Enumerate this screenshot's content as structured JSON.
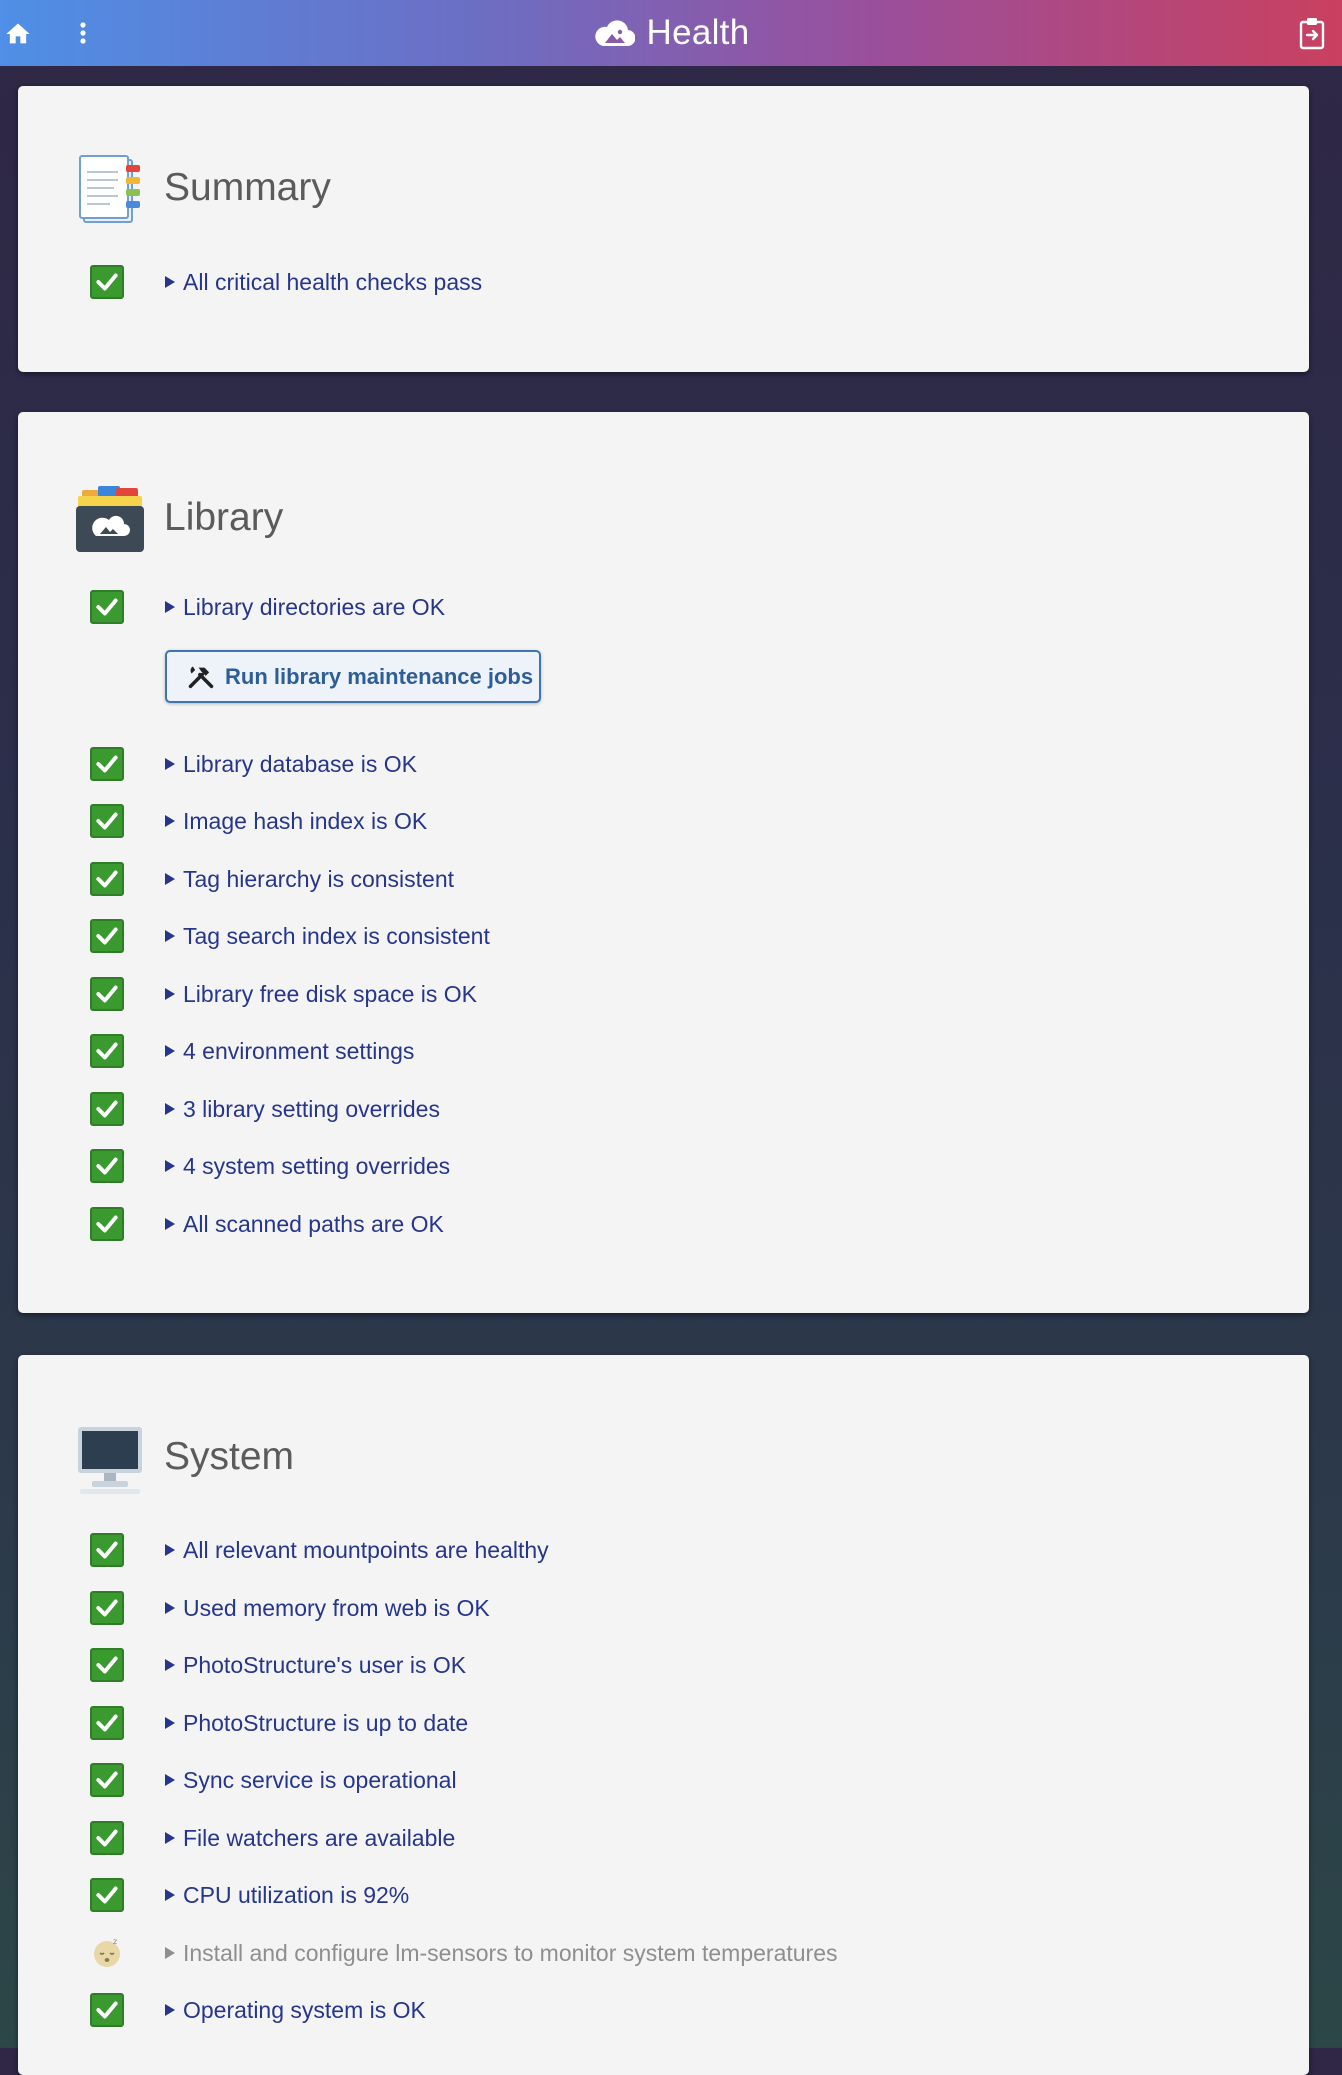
{
  "header": {
    "title": "Health",
    "icons": {
      "home": "home-icon",
      "menu": "more-vertical-icon",
      "logo": "cloud-photo-icon",
      "logout": "clipboard-logout-icon"
    }
  },
  "colors": {
    "check_green": "#3b9a2f",
    "link_blue": "#26368c",
    "title_gray": "#5b5b5b"
  },
  "summary": {
    "title": "Summary",
    "icon": "notebook-icon",
    "items": [
      {
        "status": "ok",
        "label": "All critical health checks pass"
      }
    ]
  },
  "library": {
    "title": "Library",
    "icon": "library-box-icon",
    "items": [
      {
        "status": "ok",
        "label": "Library directories are OK"
      },
      {
        "status": "ok",
        "label": "Library database is OK"
      },
      {
        "status": "ok",
        "label": "Image hash index is OK"
      },
      {
        "status": "ok",
        "label": "Tag hierarchy is consistent"
      },
      {
        "status": "ok",
        "label": "Tag search index is consistent"
      },
      {
        "status": "ok",
        "label": "Library free disk space is OK"
      },
      {
        "status": "ok",
        "label": "4 environment settings"
      },
      {
        "status": "ok",
        "label": "3 library setting overrides"
      },
      {
        "status": "ok",
        "label": "4 system setting overrides"
      },
      {
        "status": "ok",
        "label": "All scanned paths are OK"
      }
    ],
    "maintenance_button": "Run library maintenance jobs"
  },
  "system": {
    "title": "System",
    "icon": "desktop-computer-icon",
    "items": [
      {
        "status": "ok",
        "label": "All relevant mountpoints are healthy"
      },
      {
        "status": "ok",
        "label": "Used memory from web is OK"
      },
      {
        "status": "ok",
        "label": "PhotoStructure's user is OK"
      },
      {
        "status": "ok",
        "label": "PhotoStructure is up to date"
      },
      {
        "status": "ok",
        "label": "Sync service is operational"
      },
      {
        "status": "ok",
        "label": "File watchers are available"
      },
      {
        "status": "ok",
        "label": "CPU utilization is 92%"
      },
      {
        "status": "info",
        "label": "Install and configure lm-sensors to monitor system temperatures"
      },
      {
        "status": "ok",
        "label": "Operating system is OK"
      }
    ]
  }
}
